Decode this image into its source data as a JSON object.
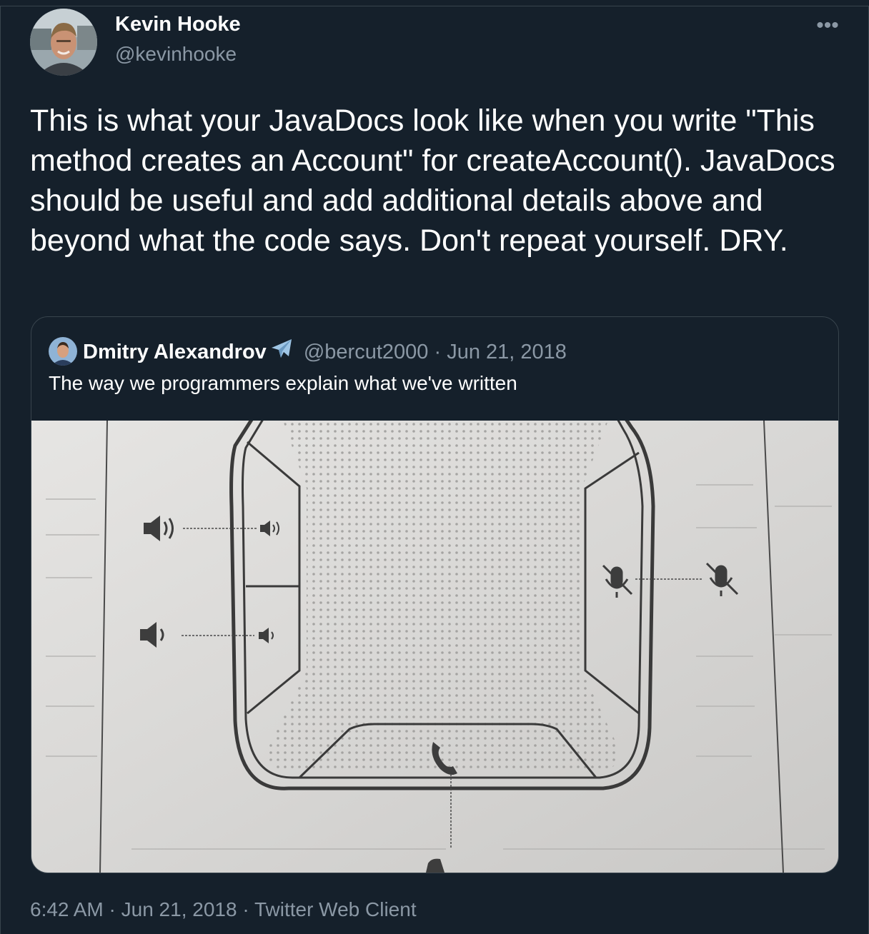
{
  "tweet": {
    "author_name": "Kevin Hooke",
    "author_handle": "@kevinhooke",
    "more_icon": "more-horizontal-icon",
    "text": "This is what your JavaDocs look like when you write \"This method creates an Account\" for createAccount(). JavaDocs should be useful and add additional details above and beyond what the code says. Don't repeat yourself. DRY.",
    "time": "6:42 AM",
    "date": "Jun 21, 2018",
    "client": "Twitter Web Client",
    "separator": "·"
  },
  "quoted": {
    "author_name": "Dmitry Alexandrov",
    "badge_icon": "airplane-emoji-icon",
    "author_handle": "@bercut2000",
    "separator": "·",
    "date": "Jun 21, 2018",
    "text": "The way we programmers explain what we've written"
  },
  "colors": {
    "background": "#15202b",
    "border": "#38444d",
    "secondary_text": "#8b98a5",
    "primary_text": "#ffffff"
  }
}
